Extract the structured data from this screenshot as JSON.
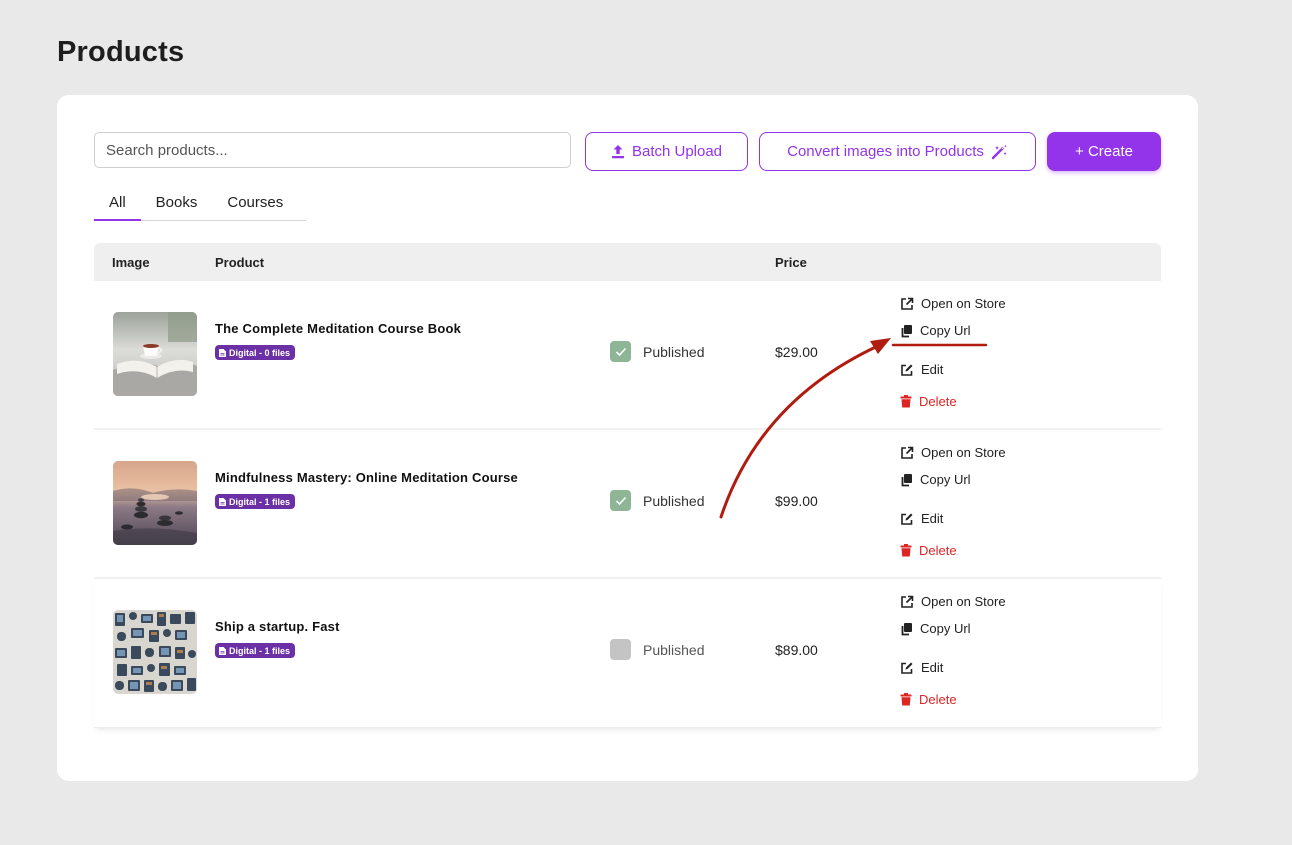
{
  "page": {
    "title": "Products"
  },
  "toolbar": {
    "search_placeholder": "Search products...",
    "batch_upload": "Batch Upload",
    "convert_images": "Convert images into Products",
    "create": "+ Create"
  },
  "tabs": [
    {
      "label": "All",
      "active": true
    },
    {
      "label": "Books",
      "active": false
    },
    {
      "label": "Courses",
      "active": false
    }
  ],
  "table": {
    "headers": {
      "image": "Image",
      "product": "Product",
      "price": "Price"
    },
    "rows": [
      {
        "name": "The Complete Meditation Course Book",
        "badge": "Digital - 0 files",
        "published": true,
        "status_label": "Published",
        "price": "$29.00",
        "thumbnail": "book-tea-image"
      },
      {
        "name": "Mindfulness Mastery: Online Meditation Course",
        "badge": "Digital - 1 files",
        "published": true,
        "status_label": "Published",
        "price": "$99.00",
        "thumbnail": "stacked-stones-image"
      },
      {
        "name": "Ship a startup. Fast",
        "badge": "Digital - 1 files",
        "published": false,
        "status_label": "Published",
        "price": "$89.00",
        "thumbnail": "tech-pattern-image"
      }
    ],
    "actions": {
      "open_on_store": "Open on Store",
      "copy_url": "Copy Url",
      "edit": "Edit",
      "delete": "Delete"
    }
  },
  "colors": {
    "accent": "#9333ea",
    "badge": "#6b2fa6",
    "published_check": "#8fb597",
    "unpublished_check": "#c4c4c4",
    "delete": "#dc2626",
    "annotation": "#b01c10"
  }
}
